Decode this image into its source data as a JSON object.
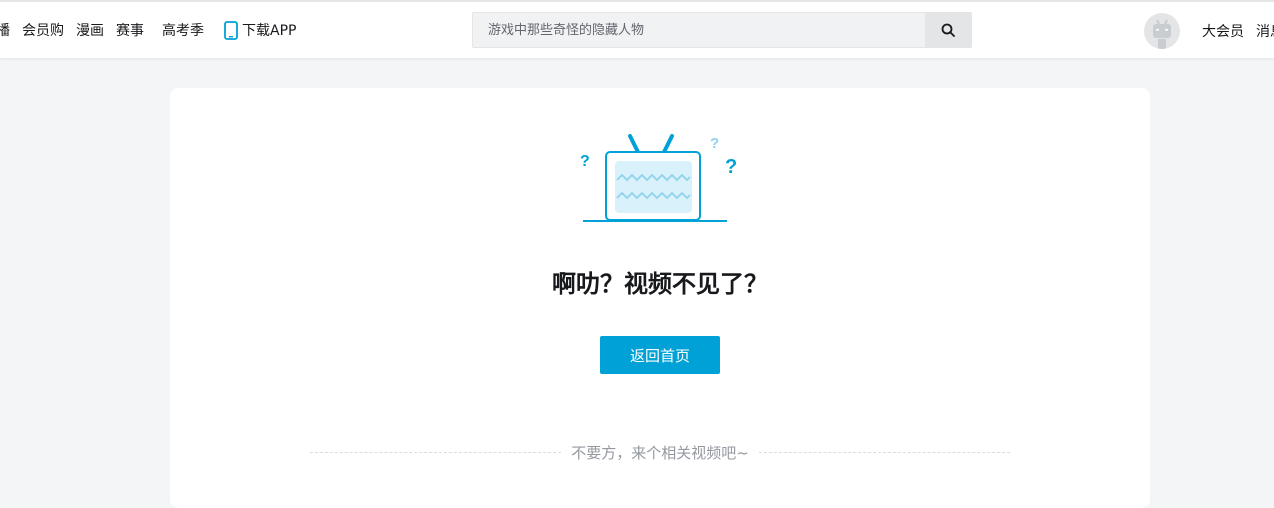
{
  "header": {
    "nav": [
      "播",
      "会员购",
      "漫画",
      "赛事",
      "高考季"
    ],
    "app_link": "下载APP",
    "search": {
      "placeholder": "游戏中那些奇怪的隐藏人物"
    },
    "right_links": [
      "大会员",
      "消息"
    ]
  },
  "error": {
    "title": "啊叻？视频不见了？",
    "home_button": "返回首页",
    "related_text": "不要方，来个相关视频吧~"
  },
  "colors": {
    "accent": "#00a1d6",
    "tv_light": "#d8f1fa"
  }
}
